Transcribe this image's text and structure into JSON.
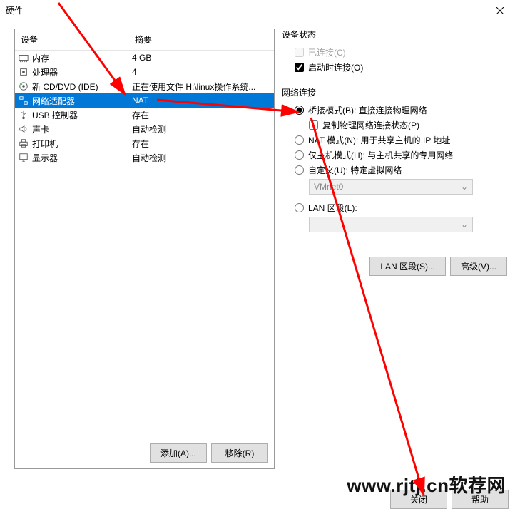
{
  "window": {
    "title": "硬件"
  },
  "headers": {
    "device": "设备",
    "summary": "摘要"
  },
  "devices": [
    {
      "icon": "memory-icon",
      "name": "内存",
      "summary": "4 GB",
      "selected": false
    },
    {
      "icon": "cpu-icon",
      "name": "处理器",
      "summary": "4",
      "selected": false
    },
    {
      "icon": "disc-icon",
      "name": "新 CD/DVD (IDE)",
      "summary": "正在使用文件 H:\\linux操作系统...",
      "selected": false
    },
    {
      "icon": "network-icon",
      "name": "网络适配器",
      "summary": "NAT",
      "selected": true
    },
    {
      "icon": "usb-icon",
      "name": "USB 控制器",
      "summary": "存在",
      "selected": false
    },
    {
      "icon": "sound-icon",
      "name": "声卡",
      "summary": "自动检测",
      "selected": false
    },
    {
      "icon": "printer-icon",
      "name": "打印机",
      "summary": "存在",
      "selected": false
    },
    {
      "icon": "display-icon",
      "name": "显示器",
      "summary": "自动检测",
      "selected": false
    }
  ],
  "buttons": {
    "add": "添加(A)...",
    "remove": "移除(R)",
    "lan_segments": "LAN 区段(S)...",
    "advanced": "高级(V)...",
    "close": "关闭",
    "help": "帮助"
  },
  "status": {
    "title": "设备状态",
    "connected_label": "已连接(C)",
    "connect_at_poweron_label": "启动时连接(O)",
    "connected": false,
    "connect_at_poweron": true
  },
  "network": {
    "title": "网络连接",
    "bridged": "桥接模式(B): 直接连接物理网络",
    "replicate": "复制物理网络连接状态(P)",
    "nat": "NAT 模式(N): 用于共享主机的 IP 地址",
    "hostonly": "仅主机模式(H): 与主机共享的专用网络",
    "custom": "自定义(U): 特定虚拟网络",
    "custom_value": "VMnet0",
    "lansegment": "LAN 区段(L):",
    "lansegment_value": "",
    "selected": "bridged",
    "replicate_checked": false
  },
  "watermark": "www.rjtj.cn软荐网"
}
